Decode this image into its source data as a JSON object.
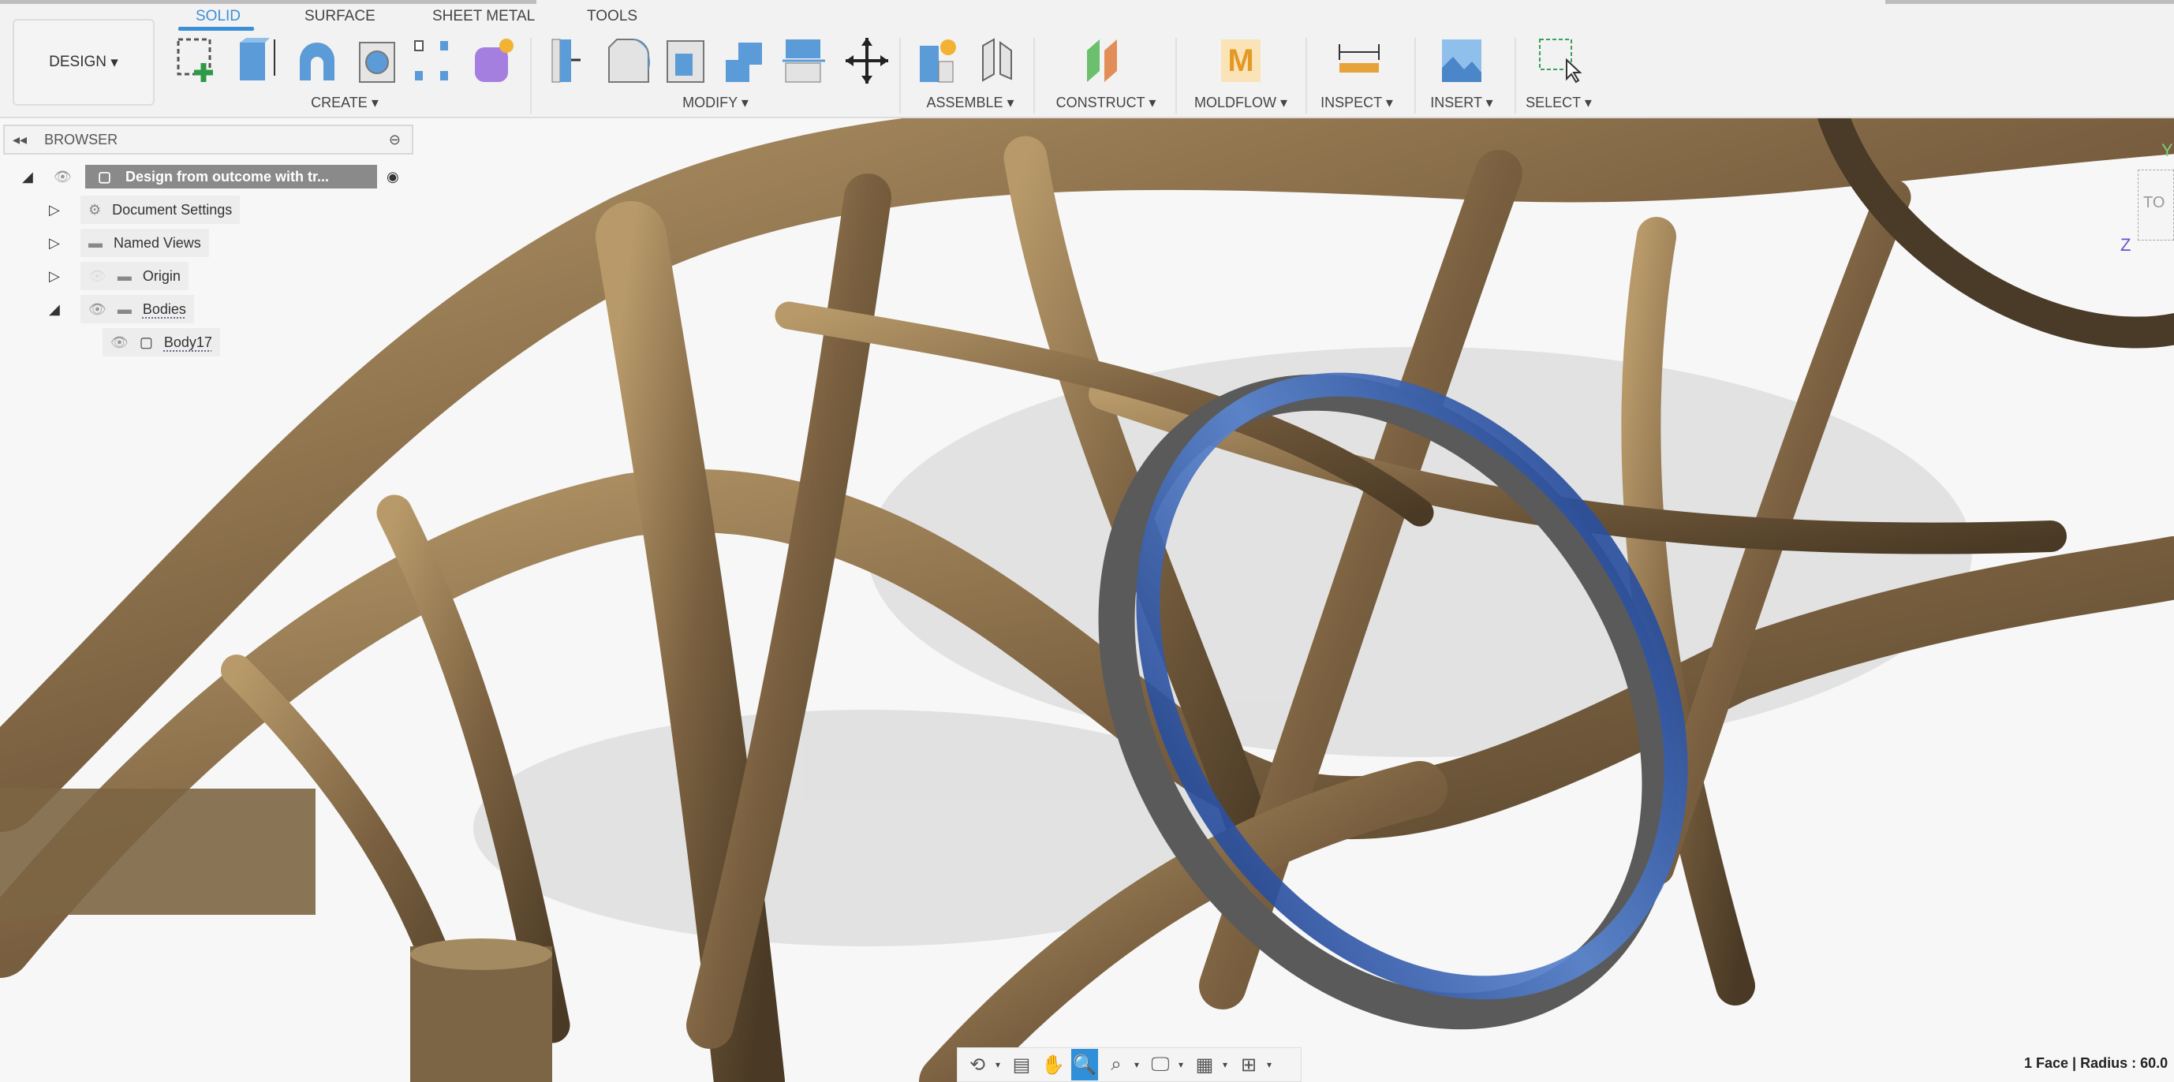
{
  "toolbar": {
    "workspace": "DESIGN",
    "tabs": [
      "SOLID",
      "SURFACE",
      "SHEET METAL",
      "TOOLS"
    ],
    "active_tab": "SOLID",
    "groups": [
      "CREATE",
      "MODIFY",
      "ASSEMBLE",
      "CONSTRUCT",
      "MOLDFLOW",
      "INSPECT",
      "INSERT",
      "SELECT"
    ]
  },
  "browser": {
    "title": "BROWSER",
    "root": "Design from outcome with tr...",
    "items": [
      "Document Settings",
      "Named Views",
      "Origin",
      "Bodies",
      "Body17"
    ]
  },
  "viewcube": {
    "face": "TO",
    "y_axis": "Y",
    "z_axis": "Z"
  },
  "status": "1 Face | Radius : 60.0",
  "colors": {
    "accent": "#3b8fd6",
    "bronze": "#8a7250",
    "selection": "#2f5fb8"
  }
}
